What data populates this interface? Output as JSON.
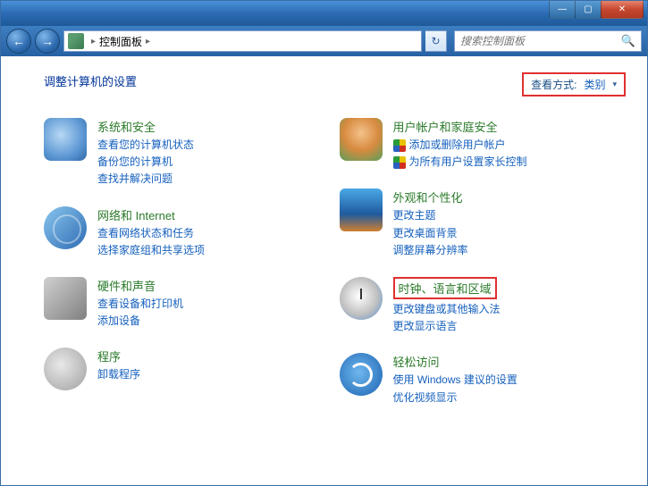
{
  "titlebar": {
    "min_glyph": "—",
    "max_glyph": "▢",
    "close_glyph": "✕"
  },
  "nav": {
    "back_glyph": "←",
    "fwd_glyph": "→",
    "breadcrumb_root": "控制面板",
    "sep": "▸",
    "refresh_glyph": "↻"
  },
  "search": {
    "placeholder": "搜索控制面板",
    "icon": "🔍"
  },
  "header": {
    "title": "调整计算机的设置",
    "view_by_label": "查看方式:",
    "view_by_value": "类别",
    "arrow": "▾"
  },
  "left": [
    {
      "title": "系统和安全",
      "icon": "ico-sys",
      "links": [
        {
          "text": "查看您的计算机状态",
          "shield": false
        },
        {
          "text": "备份您的计算机",
          "shield": false
        },
        {
          "text": "查找并解决问题",
          "shield": false
        }
      ]
    },
    {
      "title": "网络和 Internet",
      "icon": "ico-net",
      "links": [
        {
          "text": "查看网络状态和任务",
          "shield": false
        },
        {
          "text": "选择家庭组和共享选项",
          "shield": false
        }
      ]
    },
    {
      "title": "硬件和声音",
      "icon": "ico-hw",
      "links": [
        {
          "text": "查看设备和打印机",
          "shield": false
        },
        {
          "text": "添加设备",
          "shield": false
        }
      ]
    },
    {
      "title": "程序",
      "icon": "ico-prg",
      "links": [
        {
          "text": "卸载程序",
          "shield": false
        }
      ]
    }
  ],
  "right": [
    {
      "title": "用户帐户和家庭安全",
      "icon": "ico-usr",
      "links": [
        {
          "text": "添加或删除用户帐户",
          "shield": true
        },
        {
          "text": "为所有用户设置家长控制",
          "shield": true
        }
      ]
    },
    {
      "title": "外观和个性化",
      "icon": "ico-app",
      "links": [
        {
          "text": "更改主题",
          "shield": false
        },
        {
          "text": "更改桌面背景",
          "shield": false
        },
        {
          "text": "调整屏幕分辨率",
          "shield": false
        }
      ]
    },
    {
      "title": "时钟、语言和区域",
      "title_highlighted": true,
      "icon": "ico-clk",
      "links": [
        {
          "text": "更改键盘或其他输入法",
          "shield": false
        },
        {
          "text": "更改显示语言",
          "shield": false
        }
      ]
    },
    {
      "title": "轻松访问",
      "icon": "ico-acc",
      "links": [
        {
          "text": "使用 Windows 建议的设置",
          "shield": false
        },
        {
          "text": "优化视频显示",
          "shield": false
        }
      ]
    }
  ]
}
